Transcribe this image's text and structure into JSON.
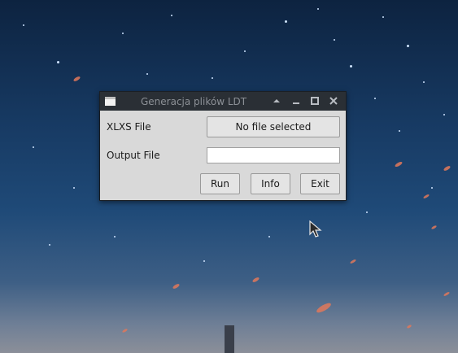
{
  "window": {
    "title": "Generacja plików LDT"
  },
  "form": {
    "xlsx_label": "XLXS File",
    "xlsx_button": "No file selected",
    "output_label": "Output File",
    "output_value": ""
  },
  "actions": {
    "run": "Run",
    "info": "Info",
    "exit": "Exit"
  },
  "colors": {
    "titlebar": "#2a2f35",
    "window_bg": "#d9d9d9",
    "desktop_top": "#0d2340"
  }
}
